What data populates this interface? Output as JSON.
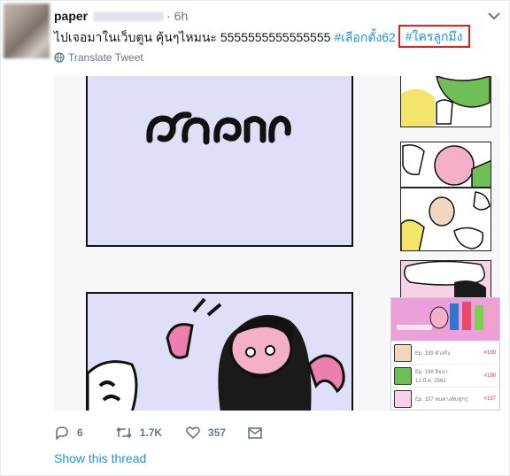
{
  "tweet": {
    "author_name": "paper",
    "time": "· 6h",
    "text_main": "ไปเจอมาในเว็บตูน คุ้นๆไหมนะ  5555555555555555 ",
    "hashtag_1": "#เลือกตั้ง62",
    "hashtag_2": "#ใครลูกมึง",
    "translate_label": "Translate Tweet",
    "reply_count": "6",
    "retweet_count": "1.7K",
    "like_count": "357",
    "show_thread_label": "Show this thread"
  },
  "media": {
    "panel1_caption": "ตัวจริง",
    "list_rows": [
      {
        "title": "Ep. 199 ตัวจริง",
        "price": "#199"
      },
      {
        "title": "Ep. 198 อิจฉา",
        "date": "12 มี.ค. 2562",
        "price": "#198"
      },
      {
        "title": "Ep. 197 หนทางลับชุกรุ่",
        "price": "#197"
      }
    ]
  },
  "colors": {
    "accent": "#1b95e0",
    "highlight_box": "#e0211b",
    "muted": "#657786",
    "panel_bg": "#dfe0f7"
  },
  "icons": [
    "chevron-down-icon",
    "globe-icon",
    "reply-icon",
    "retweet-icon",
    "like-icon",
    "share-icon"
  ]
}
